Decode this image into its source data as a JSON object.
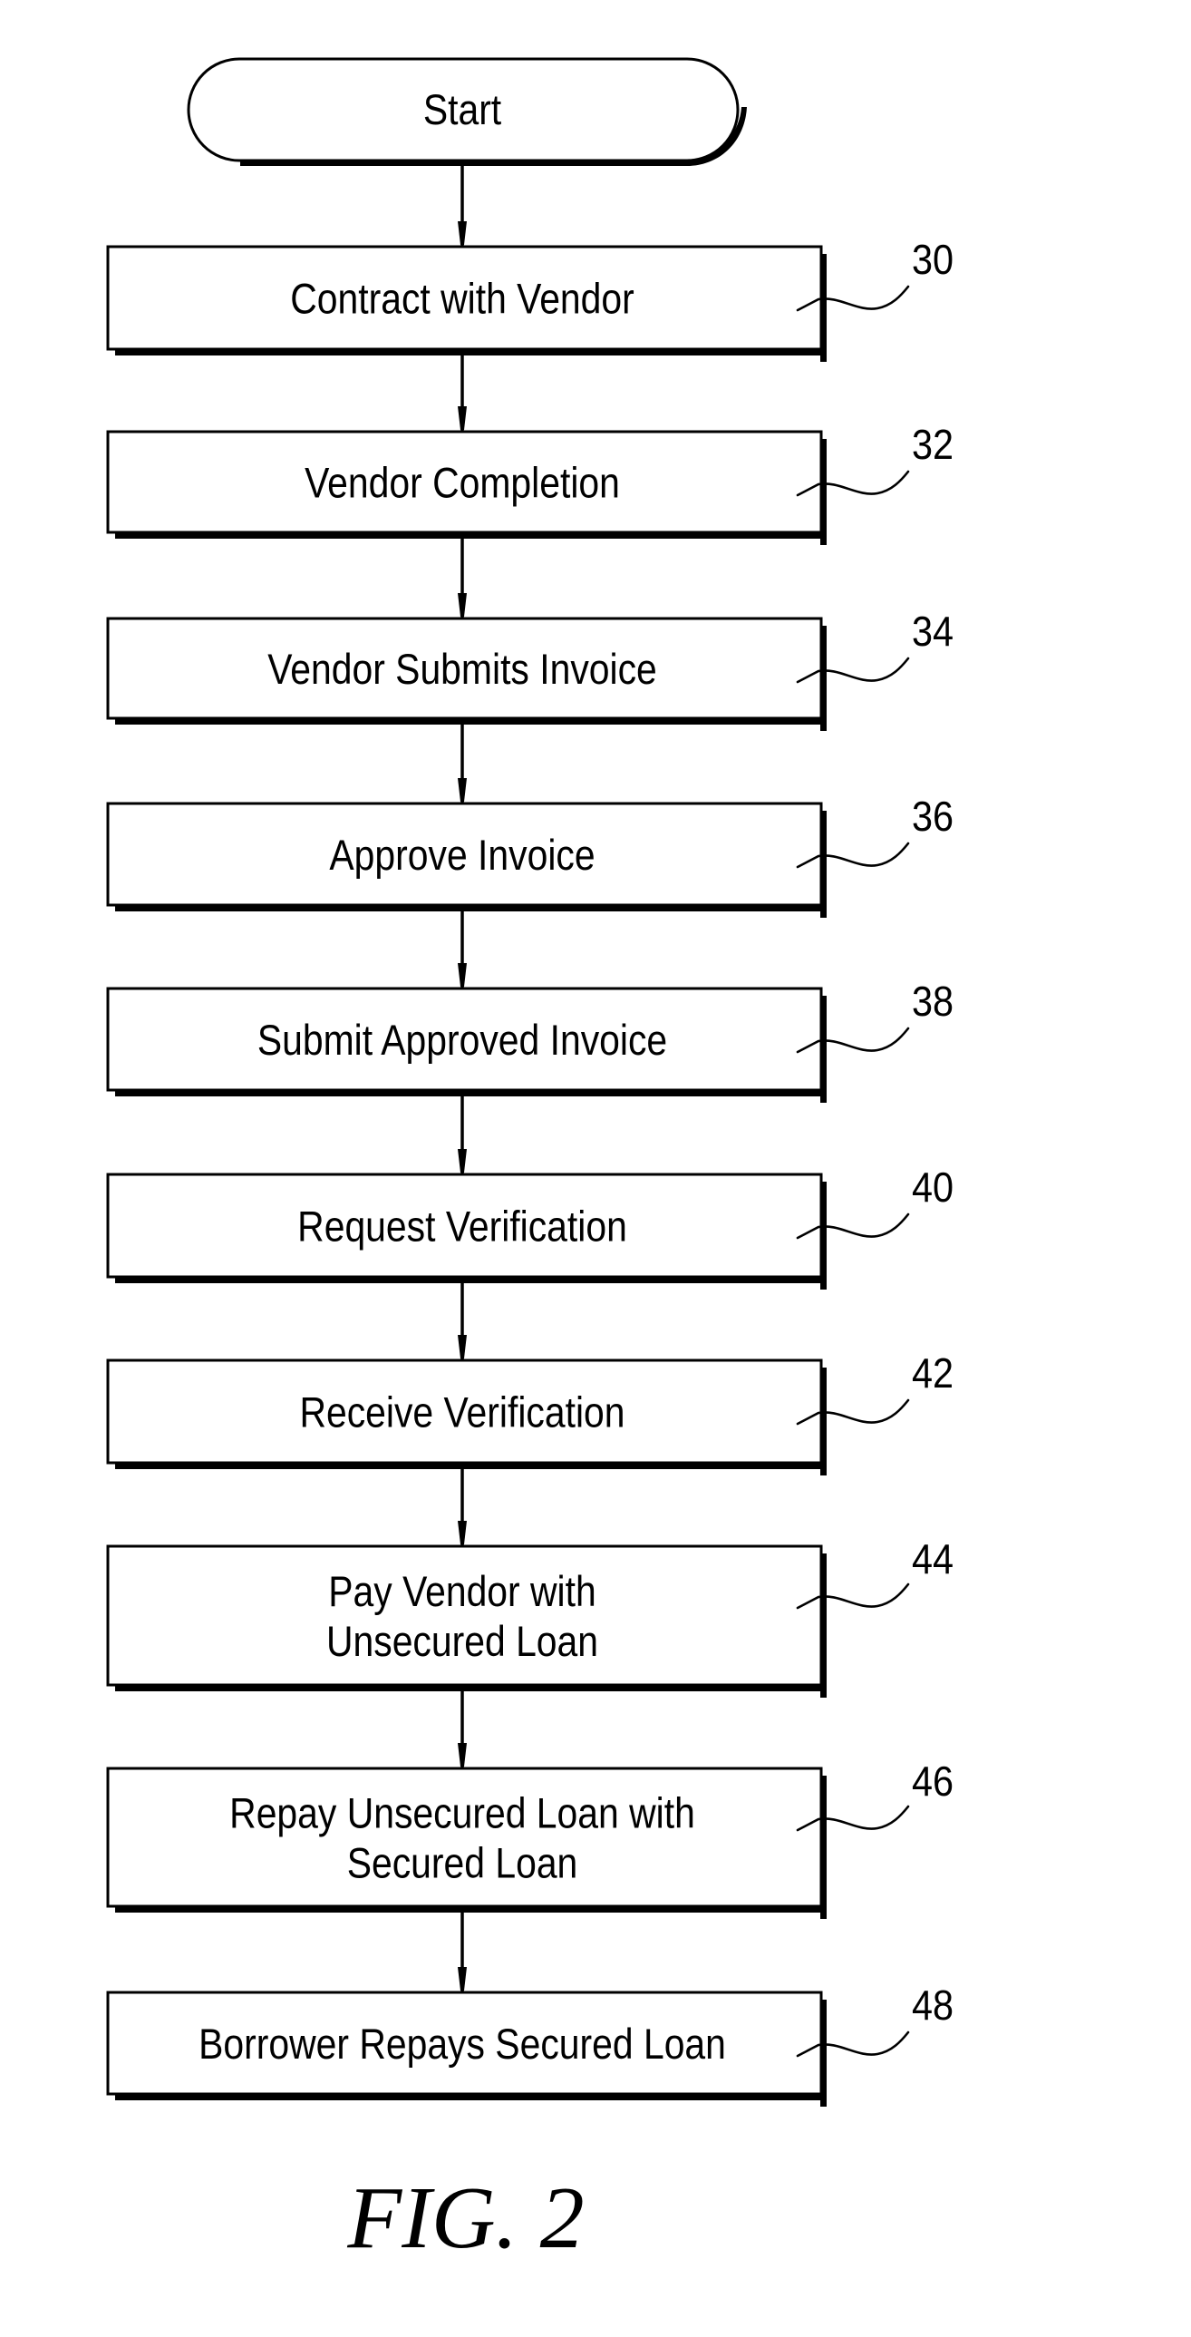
{
  "figure": {
    "caption": "FIG. 2",
    "start_label": "Start",
    "steps": [
      {
        "ref": "30",
        "lines": [
          "Contract with Vendor"
        ]
      },
      {
        "ref": "32",
        "lines": [
          "Vendor Completion"
        ]
      },
      {
        "ref": "34",
        "lines": [
          "Vendor Submits Invoice"
        ]
      },
      {
        "ref": "36",
        "lines": [
          "Approve Invoice"
        ]
      },
      {
        "ref": "38",
        "lines": [
          "Submit Approved Invoice"
        ]
      },
      {
        "ref": "40",
        "lines": [
          "Request Verification"
        ]
      },
      {
        "ref": "42",
        "lines": [
          "Receive Verification"
        ]
      },
      {
        "ref": "44",
        "lines": [
          "Pay Vendor with",
          "Unsecured Loan"
        ]
      },
      {
        "ref": "46",
        "lines": [
          "Repay Unsecured Loan with",
          "Secured Loan"
        ]
      },
      {
        "ref": "48",
        "lines": [
          "Borrower Repays Secured Loan"
        ]
      }
    ]
  }
}
